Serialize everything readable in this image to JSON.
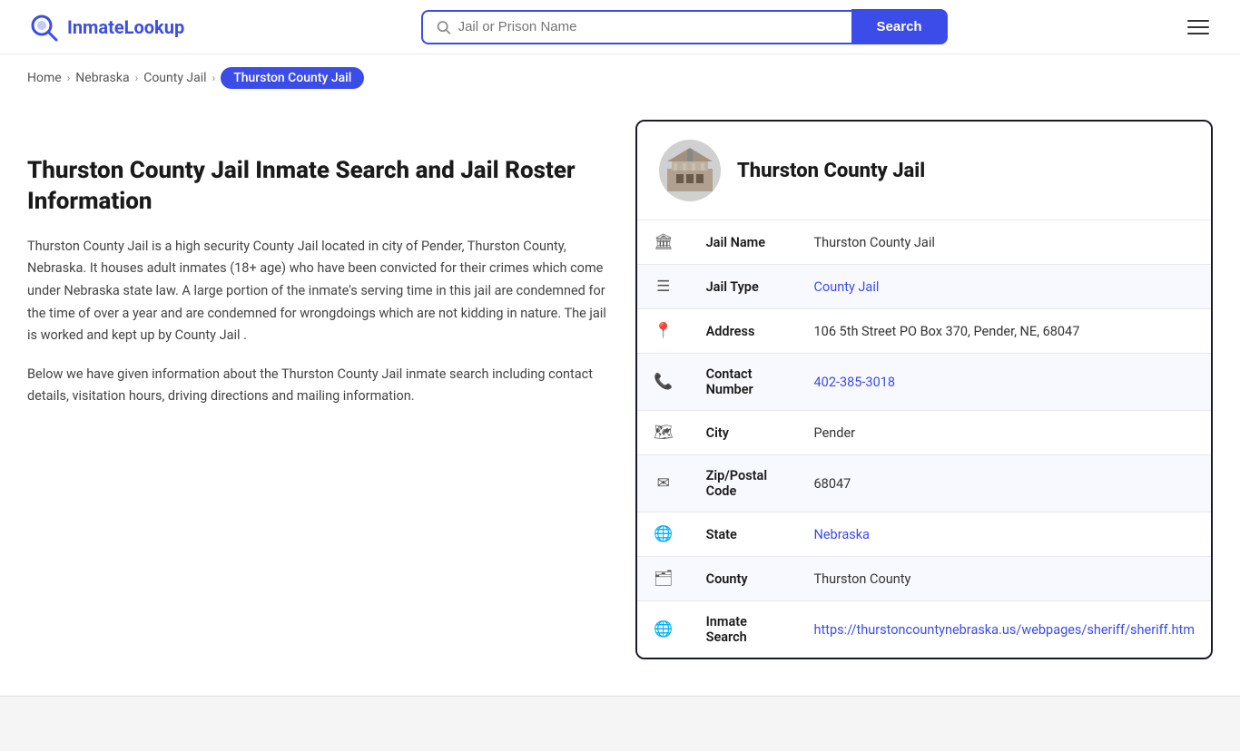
{
  "header": {
    "logo_name": "InmateLookup",
    "logo_name_highlight": "Inmate",
    "logo_name_rest": "Lookup",
    "search_placeholder": "Jail or Prison Name",
    "search_button_label": "Search"
  },
  "breadcrumb": {
    "home": "Home",
    "nebraska": "Nebraska",
    "county_jail": "County Jail",
    "active": "Thurston County Jail"
  },
  "left": {
    "title": "Thurston County Jail Inmate Search and Jail Roster Information",
    "desc1": "Thurston County Jail is a high security County Jail located in city of Pender, Thurston County, Nebraska. It houses adult inmates (18+ age) who have been convicted for their crimes which come under Nebraska state law. A large portion of the inmate's serving time in this jail are condemned for the time of over a year and are condemned for wrongdoings which are not kidding in nature. The jail is worked and kept up by County Jail .",
    "desc2": "Below we have given information about the Thurston County Jail inmate search including contact details, visitation hours, driving directions and mailing information."
  },
  "card": {
    "title": "Thurston County Jail",
    "rows": [
      {
        "icon": "jail-icon",
        "label": "Jail Name",
        "value": "Thurston County Jail",
        "link": false
      },
      {
        "icon": "type-icon",
        "label": "Jail Type",
        "value": "County Jail",
        "link": true,
        "href": "#"
      },
      {
        "icon": "address-icon",
        "label": "Address",
        "value": "106 5th Street PO Box 370, Pender, NE, 68047",
        "link": false
      },
      {
        "icon": "phone-icon",
        "label": "Contact Number",
        "value": "402-385-3018",
        "link": true,
        "href": "tel:402-385-3018"
      },
      {
        "icon": "city-icon",
        "label": "City",
        "value": "Pender",
        "link": false
      },
      {
        "icon": "zip-icon",
        "label": "Zip/Postal Code",
        "value": "68047",
        "link": false
      },
      {
        "icon": "state-icon",
        "label": "State",
        "value": "Nebraska",
        "link": true,
        "href": "#"
      },
      {
        "icon": "county-icon",
        "label": "County",
        "value": "Thurston County",
        "link": false
      },
      {
        "icon": "inmate-search-icon",
        "label": "Inmate Search",
        "value": "https://thurstoncountynebraska.us/webpages/sheriff/sheriff.htm",
        "link": true,
        "href": "https://thurstoncountynebraska.us/webpages/sheriff/sheriff.htm"
      }
    ]
  },
  "icons": {
    "jail-icon": "🏛",
    "type-icon": "☰",
    "address-icon": "📍",
    "phone-icon": "📞",
    "city-icon": "🗺",
    "zip-icon": "✉",
    "state-icon": "🌐",
    "county-icon": "🗂",
    "inmate-search-icon": "🌐"
  }
}
